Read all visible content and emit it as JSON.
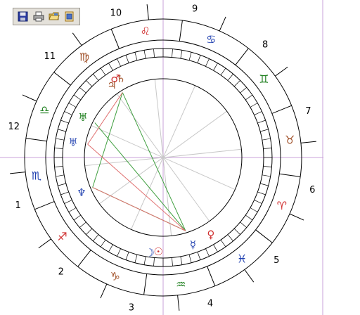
{
  "toolbar": {
    "buttons": [
      {
        "name": "save",
        "icon": "floppy-disk-icon"
      },
      {
        "name": "print",
        "icon": "printer-icon"
      },
      {
        "name": "open",
        "icon": "open-folder-icon"
      },
      {
        "name": "export",
        "icon": "export-icon"
      }
    ]
  },
  "chart": {
    "houses": [
      {
        "num": "1"
      },
      {
        "num": "2"
      },
      {
        "num": "3"
      },
      {
        "num": "4"
      },
      {
        "num": "5"
      },
      {
        "num": "6"
      },
      {
        "num": "7"
      },
      {
        "num": "8"
      },
      {
        "num": "9"
      },
      {
        "num": "10"
      },
      {
        "num": "11"
      },
      {
        "num": "12"
      }
    ],
    "signs": [
      {
        "glyph": "♐",
        "name": "sagittarius",
        "color": "#d03030"
      },
      {
        "glyph": "♑",
        "name": "capricorn",
        "color": "#a05028"
      },
      {
        "glyph": "♒",
        "name": "aquarius",
        "color": "#208020"
      },
      {
        "glyph": "♓",
        "name": "pisces",
        "color": "#2040b0"
      },
      {
        "glyph": "♈",
        "name": "aries",
        "color": "#d03030"
      },
      {
        "glyph": "♉",
        "name": "taurus",
        "color": "#a05028"
      },
      {
        "glyph": "♊",
        "name": "gemini",
        "color": "#208020"
      },
      {
        "glyph": "♋",
        "name": "cancer",
        "color": "#2040b0"
      },
      {
        "glyph": "♌",
        "name": "leo",
        "color": "#d03030"
      },
      {
        "glyph": "♍",
        "name": "virgo",
        "color": "#a05028"
      },
      {
        "glyph": "♎",
        "name": "libra",
        "color": "#208020"
      },
      {
        "glyph": "♏",
        "name": "scorpio",
        "color": "#2040b0"
      }
    ],
    "planets": [
      {
        "glyph": "♄",
        "name": "saturn",
        "color": "#a05028"
      },
      {
        "glyph": "♂",
        "name": "mars",
        "color": "#d03030"
      },
      {
        "glyph": "♃",
        "name": "jupiter",
        "color": "#a05028"
      },
      {
        "glyph": "♅",
        "name": "uranus",
        "color": "#208020"
      },
      {
        "glyph": "♅",
        "name": "uranus-alt",
        "color": "#2040b0"
      },
      {
        "glyph": "♆",
        "name": "neptune",
        "color": "#2040b0"
      },
      {
        "glyph": "♀",
        "name": "venus",
        "color": "#d03030"
      },
      {
        "glyph": "☿",
        "name": "mercury",
        "color": "#2040b0"
      },
      {
        "glyph": "☽",
        "name": "moon",
        "color": "#2040b0"
      },
      {
        "glyph": "☉",
        "name": "sun",
        "color": "#d03030"
      }
    ],
    "colors": {
      "aspect_green": "#40a040",
      "aspect_red": "#e07070",
      "guide_line": "#c8a0d8",
      "house_line": "#c8c8c8",
      "ring_stroke": "#000000"
    }
  }
}
